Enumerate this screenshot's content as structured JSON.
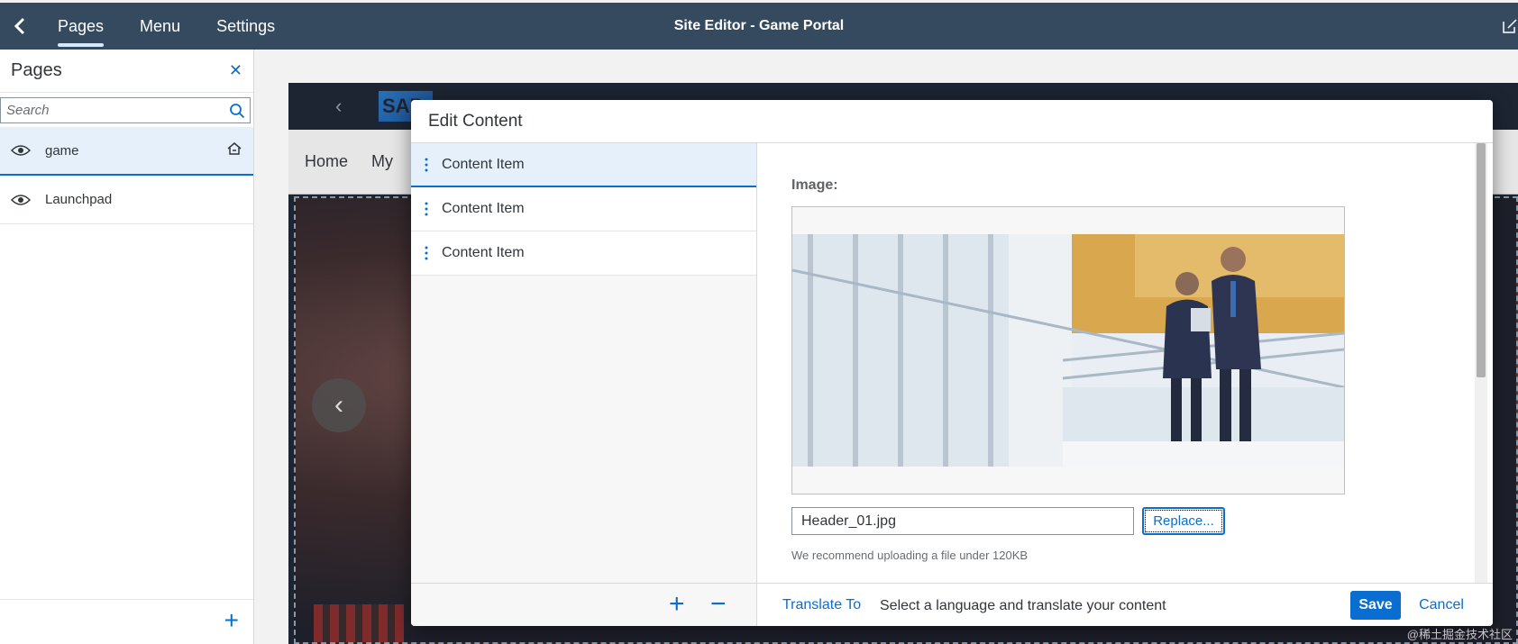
{
  "header": {
    "title": "Site Editor - Game Portal",
    "tabs": [
      {
        "label": "Pages"
      },
      {
        "label": "Menu"
      },
      {
        "label": "Settings"
      }
    ]
  },
  "pages_panel": {
    "title": "Pages",
    "search_placeholder": "Search",
    "items": [
      {
        "label": "game",
        "home": true
      },
      {
        "label": "Launchpad",
        "home": false
      }
    ]
  },
  "preview": {
    "logo": "SAP",
    "nav": [
      "Home",
      "My"
    ]
  },
  "edit_dialog": {
    "title": "Edit Content",
    "items": [
      {
        "label": "Content Item"
      },
      {
        "label": "Content Item"
      },
      {
        "label": "Content Item"
      }
    ],
    "image_label": "Image:",
    "file_name": "Header_01.jpg",
    "replace_label": "Replace...",
    "hint": "We recommend uploading a file under 120KB",
    "translate_label": "Translate To",
    "translate_desc": "Select a language and translate your content",
    "save_label": "Save",
    "cancel_label": "Cancel"
  },
  "watermark": "@稀土掘金技术社区"
}
